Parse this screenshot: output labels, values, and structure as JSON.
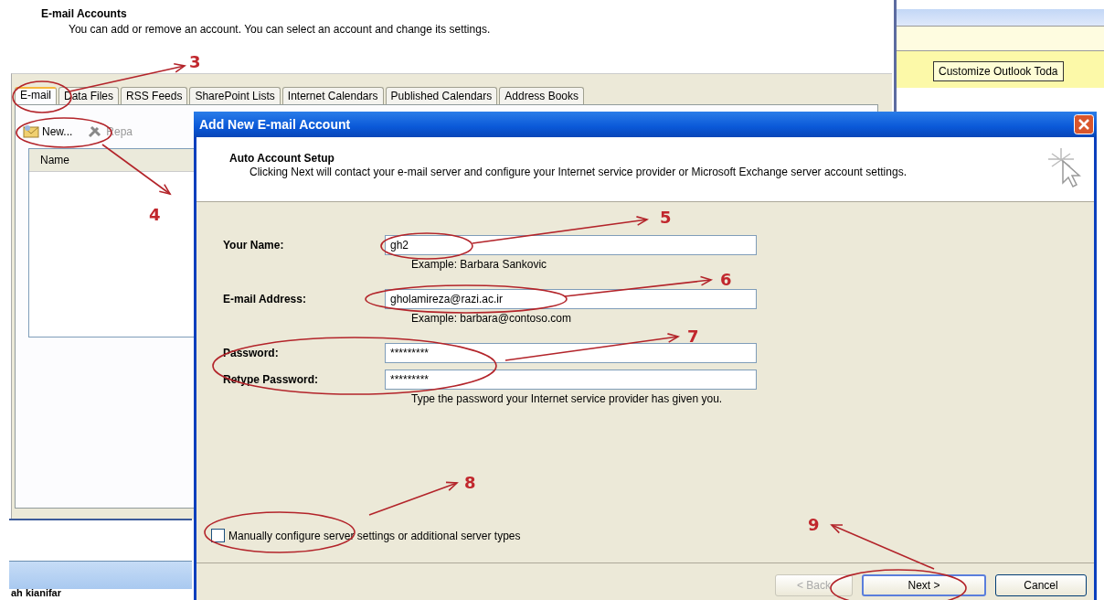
{
  "account_settings": {
    "title": "E-mail Accounts",
    "description": "You can add or remove an account. You can select an account and change its settings.",
    "tabs": [
      {
        "label": "E-mail",
        "selected": true
      },
      {
        "label": "Data Files",
        "selected": false
      },
      {
        "label": "RSS Feeds",
        "selected": false
      },
      {
        "label": "SharePoint Lists",
        "selected": false
      },
      {
        "label": "Internet Calendars",
        "selected": false
      },
      {
        "label": "Published Calendars",
        "selected": false
      },
      {
        "label": "Address Books",
        "selected": false
      }
    ],
    "toolbar": [
      {
        "label": "New...",
        "kind": "new"
      },
      {
        "label": "Repa",
        "kind": "repair"
      }
    ],
    "list_columns": [
      "Name"
    ]
  },
  "side_pane": {
    "button": "Customize Outlook Toda"
  },
  "bottom_bar": {
    "text": "ah kianifar"
  },
  "dialog": {
    "title": "Add New E-mail Account",
    "header": {
      "title": "Auto Account Setup",
      "description": "Clicking Next will contact your e-mail server and configure your Internet service provider or Microsoft Exchange server account settings."
    },
    "fields": [
      {
        "label": "Your Name:",
        "value": "gh2",
        "hint": "Example: Barbara Sankovic"
      },
      {
        "label": "E-mail Address:",
        "value": "gholamireza@razi.ac.ir",
        "hint": "Example: barbara@contoso.com"
      },
      {
        "label": "Password:",
        "value": "*********"
      },
      {
        "label": "Retype Password:",
        "value": "*********",
        "hint": "Type the password your Internet service provider has given you."
      }
    ],
    "manual_config": {
      "label": "Manually configure server settings or additional server types",
      "checked": false
    },
    "buttons": [
      {
        "label": "< Back",
        "disabled": true,
        "default": false
      },
      {
        "label": "Next >",
        "disabled": false,
        "default": true
      },
      {
        "label": "Cancel",
        "disabled": false,
        "default": false
      }
    ]
  },
  "annotations": [
    {
      "number": "3"
    },
    {
      "number": "4"
    },
    {
      "number": "5"
    },
    {
      "number": "6"
    },
    {
      "number": "7"
    },
    {
      "number": "8"
    },
    {
      "number": "9"
    }
  ]
}
